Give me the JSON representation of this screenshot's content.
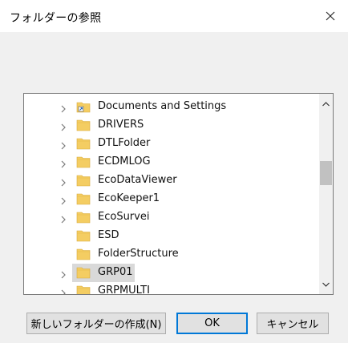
{
  "dialog": {
    "title": "フォルダーの参照",
    "close_icon": "close-icon"
  },
  "tree": {
    "items": [
      {
        "label": "Documents and Settings",
        "expandable": true,
        "icon": "shortcut-folder-icon",
        "selected": false
      },
      {
        "label": "DRIVERS",
        "expandable": true,
        "icon": "folder-icon",
        "selected": false
      },
      {
        "label": "DTLFolder",
        "expandable": true,
        "icon": "folder-icon",
        "selected": false
      },
      {
        "label": "ECDMLOG",
        "expandable": true,
        "icon": "folder-icon",
        "selected": false
      },
      {
        "label": "EcoDataViewer",
        "expandable": true,
        "icon": "folder-icon",
        "selected": false
      },
      {
        "label": "EcoKeeper1",
        "expandable": true,
        "icon": "folder-icon",
        "selected": false
      },
      {
        "label": "EcoSurvei",
        "expandable": true,
        "icon": "folder-icon",
        "selected": false
      },
      {
        "label": "ESD",
        "expandable": false,
        "icon": "folder-icon",
        "selected": false
      },
      {
        "label": "FolderStructure",
        "expandable": false,
        "icon": "folder-icon",
        "selected": false
      },
      {
        "label": "GRP01",
        "expandable": true,
        "icon": "folder-icon",
        "selected": true
      },
      {
        "label": "GRPMULTI",
        "expandable": true,
        "icon": "folder-icon",
        "selected": false
      }
    ]
  },
  "buttons": {
    "new_folder": "新しいフォルダーの作成(N)",
    "ok": "OK",
    "cancel": "キャンセル"
  },
  "colors": {
    "folder": "#f4cd62",
    "selection": "#d9d9d9",
    "ok_border": "#0078d7"
  }
}
